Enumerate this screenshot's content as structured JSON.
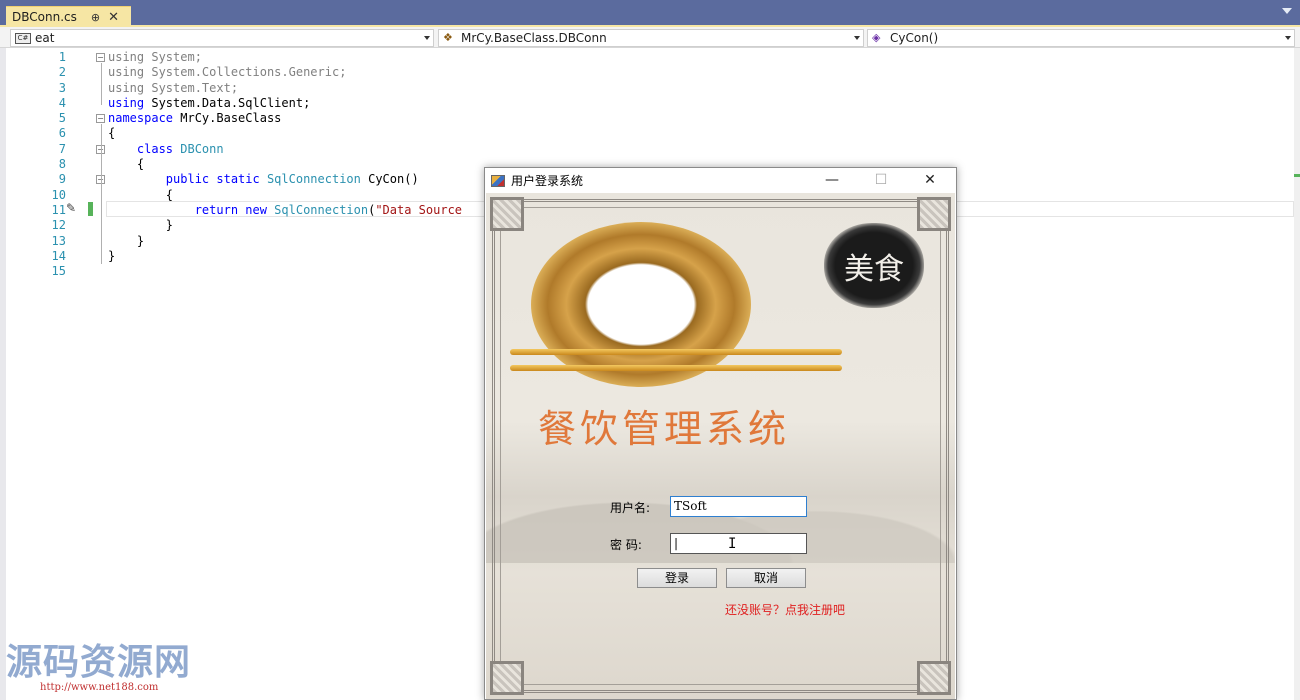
{
  "tab": {
    "name": "DBConn.cs",
    "pin": "⊕",
    "close": "✕"
  },
  "nav": {
    "project": "eat",
    "class_path": "MrCy.BaseClass.DBConn",
    "member": "CyCon()"
  },
  "editor": {
    "line_numbers": [
      "1",
      "2",
      "3",
      "4",
      "5",
      "6",
      "7",
      "8",
      "9",
      "10",
      "11",
      "12",
      "13",
      "14",
      "15"
    ],
    "lines": [
      [
        {
          "t": "using",
          "c": "gray"
        },
        {
          "t": " System;",
          "c": "gray"
        }
      ],
      [
        {
          "t": "using",
          "c": "gray"
        },
        {
          "t": " System.Collections.Generic;",
          "c": "gray"
        }
      ],
      [
        {
          "t": "using",
          "c": "gray"
        },
        {
          "t": " System.Text;",
          "c": "gray"
        }
      ],
      [
        {
          "t": "using",
          "c": "kw"
        },
        {
          "t": " System.Data.SqlClient;",
          "c": ""
        }
      ],
      [
        {
          "t": "namespace",
          "c": "kw"
        },
        {
          "t": " MrCy.BaseClass",
          "c": ""
        }
      ],
      [
        {
          "t": "{",
          "c": ""
        }
      ],
      [
        {
          "t": "    class ",
          "c": "kw"
        },
        {
          "t": "DBConn",
          "c": "type"
        }
      ],
      [
        {
          "t": "    {",
          "c": ""
        }
      ],
      [
        {
          "t": "        public static ",
          "c": "kw"
        },
        {
          "t": "SqlConnection",
          "c": "type"
        },
        {
          "t": " CyCon()",
          "c": ""
        }
      ],
      [
        {
          "t": "        {",
          "c": ""
        }
      ],
      [
        {
          "t": "            return new ",
          "c": "kw"
        },
        {
          "t": "SqlConnection",
          "c": "type"
        },
        {
          "t": "(",
          "c": ""
        },
        {
          "t": "\"Data Source",
          "c": "str"
        }
      ],
      [
        {
          "t": "        }",
          "c": ""
        }
      ],
      [
        {
          "t": "    }",
          "c": ""
        }
      ],
      [
        {
          "t": "}",
          "c": ""
        }
      ],
      [
        {
          "t": "",
          "c": ""
        }
      ]
    ]
  },
  "dialog": {
    "title": "用户登录系统",
    "minimize": "—",
    "maximize": "☐",
    "close": "✕",
    "seal_text": "美食",
    "app_title": "餐饮管理系统",
    "username_label": "用户名:",
    "username_value": "TSoft",
    "password_label": "密  码:",
    "password_value": "|",
    "login_button": "登录",
    "cancel_button": "取消",
    "register_link": "还没账号？点我注册吧"
  },
  "watermark": {
    "text": "源码资源网",
    "url": "http://www.net188.com"
  },
  "colors": {
    "tab_strip": "#5b6b9e",
    "active_tab": "#f6e6a4",
    "keyword": "#0000ff",
    "type": "#2b91af",
    "string": "#a31515",
    "app_title": "#e0783a",
    "register_link": "#e02020"
  }
}
